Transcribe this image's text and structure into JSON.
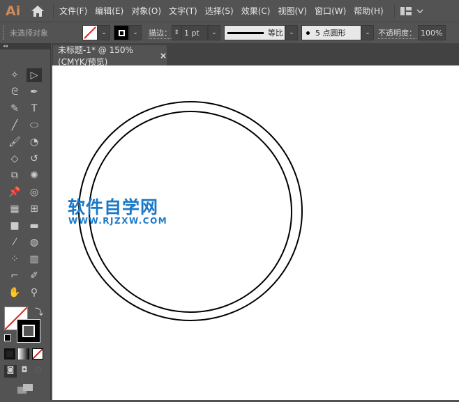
{
  "app": {
    "logo": "Ai"
  },
  "menu": [
    "文件(F)",
    "编辑(E)",
    "对象(O)",
    "文字(T)",
    "选择(S)",
    "效果(C)",
    "视图(V)",
    "窗口(W)",
    "帮助(H)"
  ],
  "control": {
    "selection": "未选择对象",
    "stroke_label": "描边：",
    "stroke_weight": "1 pt",
    "profile": "等比",
    "brush": "5 点圆形",
    "opacity_label": "不透明度：",
    "opacity": "100%"
  },
  "document_tab": {
    "title": "未标题-1* @ 150% (CMYK/预览)",
    "close": "×"
  },
  "tools": [
    "magic-wand",
    "selection",
    "lasso",
    "pen",
    "curvature",
    "type",
    "line",
    "ellipse",
    "paintbrush",
    "shaper",
    "eraser",
    "rotate",
    "scale",
    "puppet-warp",
    "pin",
    "shape-builder",
    "perspective-grid",
    "mesh",
    "gradient",
    "measure",
    "eyedropper",
    "blend",
    "symbol-sprayer",
    "column-graph",
    "artboard",
    "slice",
    "hand",
    "zoom"
  ],
  "watermark": {
    "title": "软件自学网",
    "url": "WWW.RJZXW.COM"
  },
  "colors": {
    "accent": "#d08a58",
    "watermark": "#1a78c8",
    "none_slash": "#e02020"
  }
}
